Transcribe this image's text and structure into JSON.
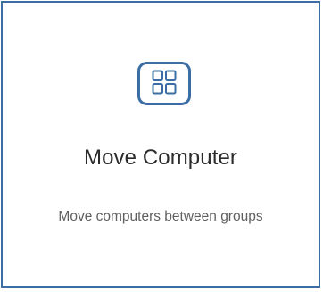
{
  "card": {
    "icon": "grid-icon",
    "title": "Move Computer",
    "description": "Move computers between groups"
  },
  "colors": {
    "accent": "#3b6ea5",
    "title_text": "#2b2b2b",
    "description_text": "#5f5f5f"
  }
}
